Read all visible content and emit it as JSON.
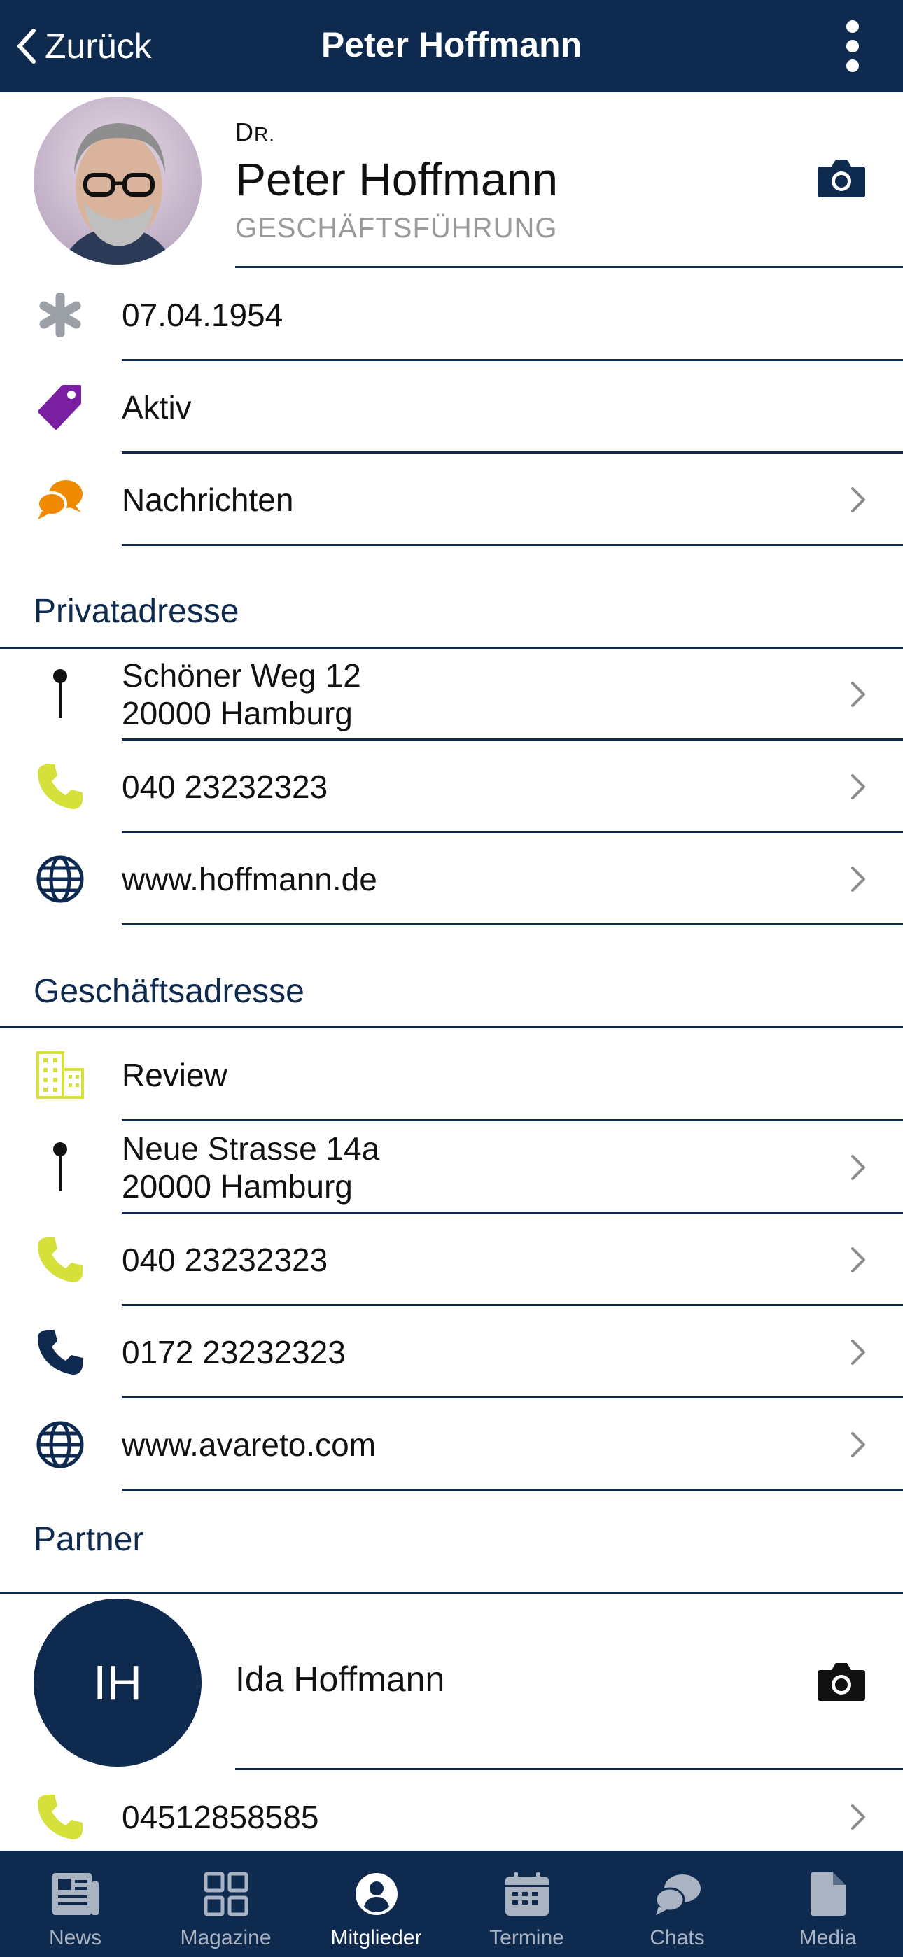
{
  "header": {
    "back_label": "Zurück",
    "title": "Peter Hoffmann"
  },
  "profile": {
    "prefix_first": "D",
    "prefix_rest": "R.",
    "name": "Peter Hoffmann",
    "role": "GESCHÄFTSFÜHRUNG"
  },
  "info": {
    "birthdate": "07.04.1954",
    "status": "Aktiv",
    "messages": "Nachrichten"
  },
  "private": {
    "title": "Privatadresse",
    "street": "Schöner Weg 12",
    "city": "20000 Hamburg",
    "phone": "040 23232323",
    "website": "www.hoffmann.de"
  },
  "business": {
    "title": "Geschäftsadresse",
    "company": "Review",
    "street": "Neue Strasse 14a",
    "city": "20000 Hamburg",
    "phone": "040 23232323",
    "mobile": "0172 23232323",
    "website": "www.avareto.com"
  },
  "partner": {
    "title": "Partner",
    "initials": "IH",
    "name": "Ida Hoffmann",
    "phone": "04512858585"
  },
  "tabs": [
    {
      "label": "News",
      "icon": "newspaper-icon"
    },
    {
      "label": "Magazine",
      "icon": "grid-icon"
    },
    {
      "label": "Mitglieder",
      "icon": "user-circle-icon"
    },
    {
      "label": "Termine",
      "icon": "calendar-icon"
    },
    {
      "label": "Chats",
      "icon": "chat-icon"
    },
    {
      "label": "Media",
      "icon": "document-icon"
    }
  ],
  "colors": {
    "navy": "#0f2a4f",
    "lime": "#d6e03a",
    "purple": "#7b1fa2",
    "orange": "#f08a00",
    "gray_icon": "#9aa0a6"
  }
}
